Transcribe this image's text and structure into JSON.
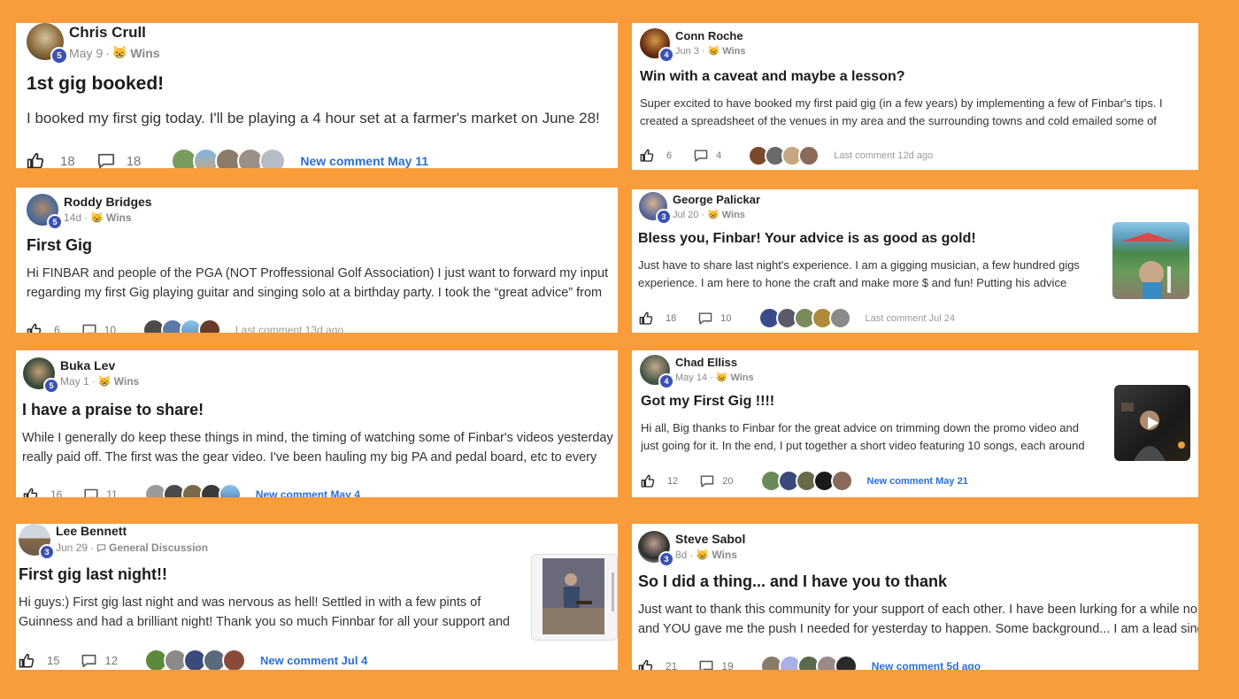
{
  "posts": [
    {
      "author": "Chris Crull",
      "level": "5",
      "date": "May 9",
      "category": "Wins",
      "title": "1st gig booked!",
      "lines": [
        "I booked my first gig today. I'll be playing a 4 hour set at a farmer's market on June 28!"
      ],
      "likes": "18",
      "comments": "18",
      "activity": "New comment May 11",
      "activity_type": "new"
    },
    {
      "author": "Conn Roche",
      "level": "4",
      "date": "Jun 3",
      "category": "Wins",
      "title": "Win with a caveat and maybe a lesson?",
      "lines": [
        "Super excited to have booked my first paid gig (in a few years) by implementing a few of Finbar's tips. I",
        "created a spreadsheet of the venues in my area and the surrounding towns and cold emailed some of"
      ],
      "likes": "6",
      "comments": "4",
      "activity": "Last comment 12d ago",
      "activity_type": "last"
    },
    {
      "author": "Roddy Bridges",
      "level": "5",
      "date": "14d",
      "category": "Wins",
      "title": "First Gig",
      "lines": [
        "Hi FINBAR and people of the PGA (NOT Proffessional Golf Association) I just want to forward my input",
        "regarding my first Gig playing guitar and singing solo at a birthday party. I took the “great advice” from"
      ],
      "likes": "6",
      "comments": "10",
      "activity": "Last comment 13d ago",
      "activity_type": "last"
    },
    {
      "author": "George Palickar",
      "level": "3",
      "date": "Jul 20",
      "category": "Wins",
      "title": "Bless you, Finbar! Your advice is as good as gold!",
      "lines": [
        "Just have to share last night's experience. I am a gigging musician, a few hundred gigs",
        "experience. I am here to hone the craft and make more $ and fun! Putting his advice"
      ],
      "likes": "18",
      "comments": "10",
      "activity": "Last comment Jul 24",
      "activity_type": "last"
    },
    {
      "author": "Buka Lev",
      "level": "5",
      "date": "May 1",
      "category": "Wins",
      "title": "I have a praise to share!",
      "lines": [
        "While I generally do keep these things in mind, the timing of watching some of Finbar's videos yesterday",
        "really paid off. The first was the gear video. I've been hauling my big PA and pedal board, etc to every"
      ],
      "likes": "16",
      "comments": "11",
      "activity": "New comment May 4",
      "activity_type": "new"
    },
    {
      "author": "Chad Elliss",
      "level": "4",
      "date": "May 14",
      "category": "Wins",
      "title": "Got my First Gig !!!!",
      "lines": [
        "Hi all, Big thanks to Finbar for the great advice on trimming down the promo video and",
        "just going for it. In the end, I put together a short video featuring 10 songs, each around"
      ],
      "likes": "12",
      "comments": "20",
      "activity": "New comment May 21",
      "activity_type": "new"
    },
    {
      "author": "Lee Bennett",
      "level": "3",
      "date": "Jun 29",
      "category": "General Discussion",
      "title": "First gig last night!!",
      "lines": [
        "Hi guys:) First gig last night and was nervous as hell! Settled in with a few pints of",
        "Guinness and had a brilliant night! Thank you so much Finnbar for all your support and"
      ],
      "likes": "15",
      "comments": "12",
      "activity": "New comment Jul 4",
      "activity_type": "new"
    },
    {
      "author": "Steve Sabol",
      "level": "3",
      "date": "8d",
      "category": "Wins",
      "title": "So I did a thing... and I have you to thank",
      "lines": [
        "Just want to thank this community for your support of each other. I have been lurking for a while no",
        "and YOU gave me the push I needed for yesterday to happen. Some background... I am a lead singe"
      ],
      "likes": "21",
      "comments": "19",
      "activity": "New comment 5d ago",
      "activity_type": "new"
    }
  ],
  "icons": {
    "like": "thumbs-up-icon",
    "comment": "comment-bubble-icon",
    "wins": "party-emoji-icon",
    "general": "speech-bubble-icon",
    "play": "play-icon"
  },
  "colors": {
    "background": "#f89c3c",
    "level_badge": "#3b52b4",
    "new_comment": "#2b6fd6"
  }
}
